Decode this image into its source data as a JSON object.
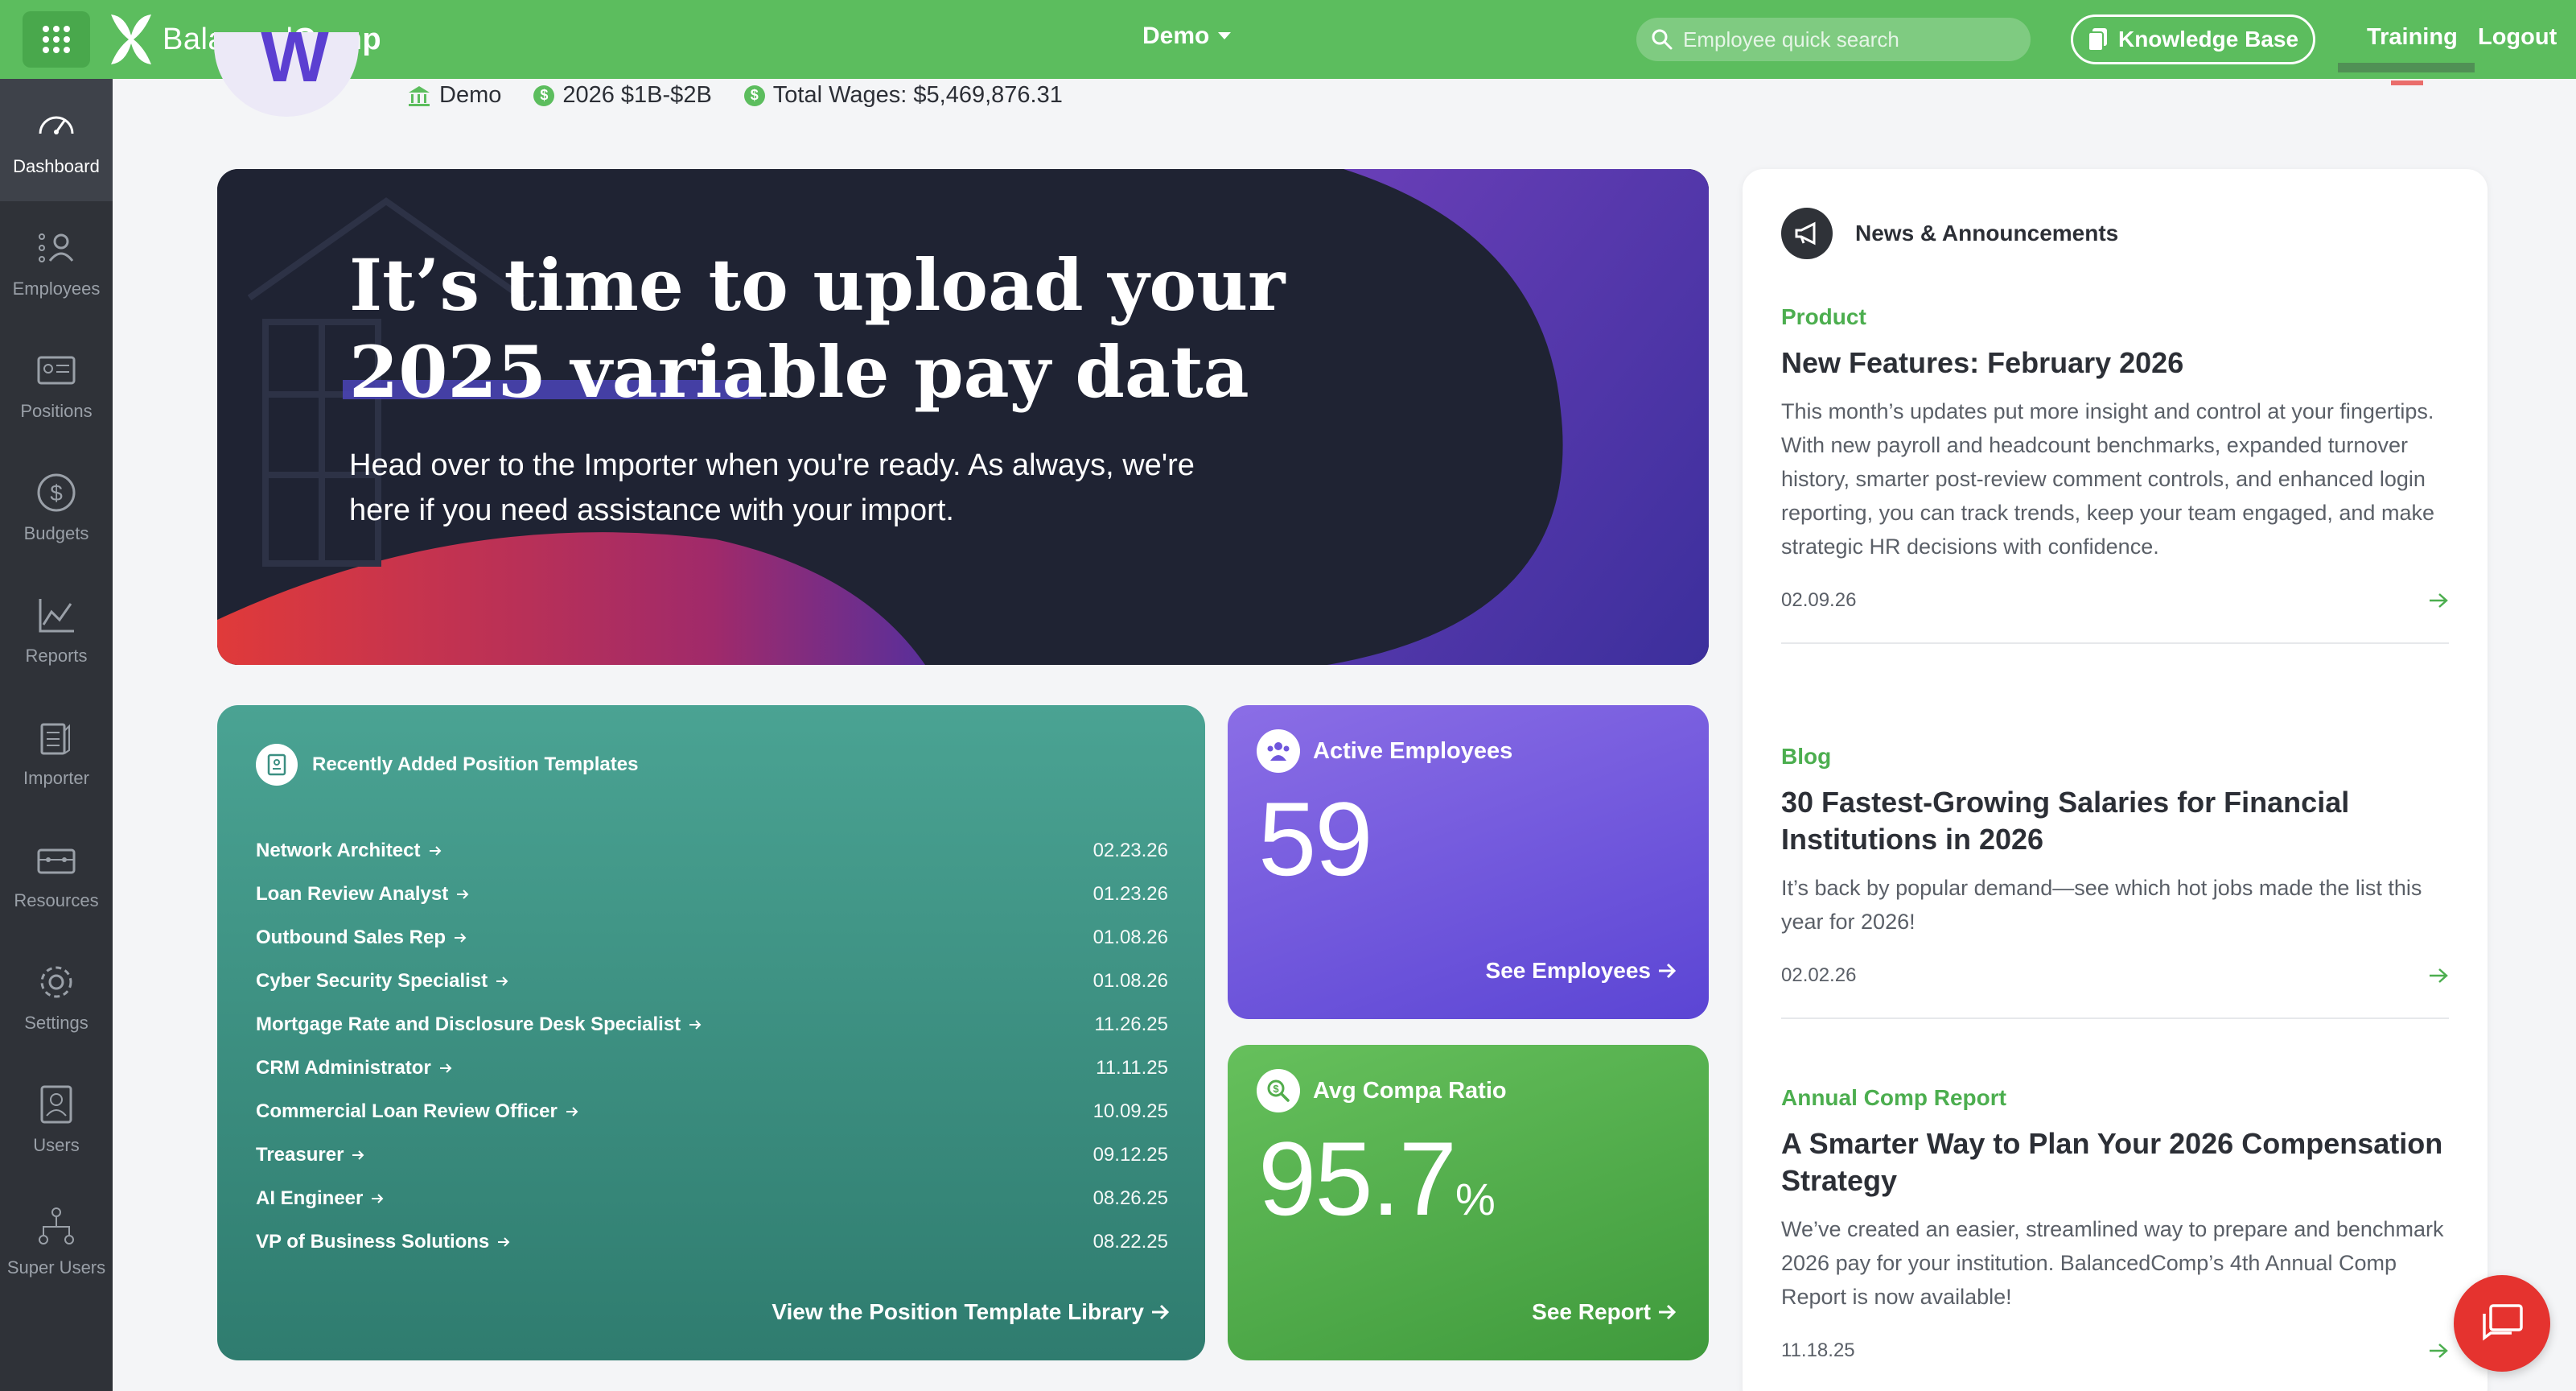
{
  "topbar": {
    "brand_light": "Balanced",
    "brand_bold": "Comp",
    "org": "Demo",
    "search_placeholder": "Employee quick search",
    "knowledge_base": "Knowledge Base",
    "training": "Training",
    "logout": "Logout"
  },
  "sidebar": {
    "items": [
      {
        "label": "Dashboard",
        "icon": "gauge-icon",
        "active": true
      },
      {
        "label": "Employees",
        "icon": "employees-icon"
      },
      {
        "label": "Positions",
        "icon": "positions-icon"
      },
      {
        "label": "Budgets",
        "icon": "dollar-icon"
      },
      {
        "label": "Reports",
        "icon": "chart-icon"
      },
      {
        "label": "Importer",
        "icon": "importer-icon"
      },
      {
        "label": "Resources",
        "icon": "resources-icon"
      },
      {
        "label": "Settings",
        "icon": "gear-icon"
      },
      {
        "label": "Users",
        "icon": "user-badge-icon"
      },
      {
        "label": "Super Users",
        "icon": "org-chart-icon"
      }
    ]
  },
  "header": {
    "org": "Demo",
    "asset_band": "2026 $1B-$2B",
    "total_wages": "Total Wages: $5,469,876.31"
  },
  "banner": {
    "title": "It’s time to upload your 2025 variable pay data",
    "subtitle": "Head over to the Importer when you're ready. As always, we're here if you need assistance with your import."
  },
  "templates": {
    "title": "Recently Added Position Templates",
    "items": [
      {
        "name": "Network Architect",
        "date": "02.23.26"
      },
      {
        "name": "Loan Review Analyst",
        "date": "01.23.26"
      },
      {
        "name": "Outbound Sales Rep",
        "date": "01.08.26"
      },
      {
        "name": "Cyber Security Specialist",
        "date": "01.08.26"
      },
      {
        "name": "Mortgage Rate and Disclosure Desk Specialist",
        "date": "11.26.25"
      },
      {
        "name": "CRM Administrator",
        "date": "11.11.25"
      },
      {
        "name": "Commercial Loan Review Officer",
        "date": "10.09.25"
      },
      {
        "name": "Treasurer",
        "date": "09.12.25"
      },
      {
        "name": "AI Engineer",
        "date": "08.26.25"
      },
      {
        "name": "VP of Business Solutions",
        "date": "08.22.25"
      }
    ],
    "link": "View the Position Template Library"
  },
  "active_employees": {
    "title": "Active Employees",
    "value": "59",
    "link": "See Employees"
  },
  "compa_ratio": {
    "title": "Avg Compa Ratio",
    "value": "95.7",
    "unit": "%",
    "link": "See Report"
  },
  "news": {
    "title": "News & Announcements",
    "articles": [
      {
        "category": "Product",
        "title": "New Features: February 2026",
        "body": "This month’s updates put more insight and control at your fingertips. With new payroll and headcount benchmarks, expanded turnover history, smarter post-review comment controls, and enhanced login reporting, you can track trends, keep your team engaged, and make strategic HR decisions with confidence.",
        "date": "02.09.26"
      },
      {
        "category": "Blog",
        "title": "30 Fastest-Growing Salaries for Financial Institutions in 2026",
        "body": "It’s back by popular demand—see which hot jobs made the list this year for 2026!",
        "date": "02.02.26"
      },
      {
        "category": "Annual Comp Report",
        "title": "A Smarter Way to Plan Your 2026 Compensation Strategy",
        "body": "We’ve created an easier, streamlined way to prepare and benchmark 2026 pay for your institution. BalancedComp’s 4th Annual Comp Report is now available!",
        "date": "11.18.25"
      }
    ]
  },
  "colors": {
    "brand_green": "#5cbd5e",
    "sidebar": "#2f3238",
    "teal_card": "#3b8f82",
    "purple_card": "#6f56dc",
    "green_card": "#52ad4c",
    "chat_red": "#e5332f"
  }
}
